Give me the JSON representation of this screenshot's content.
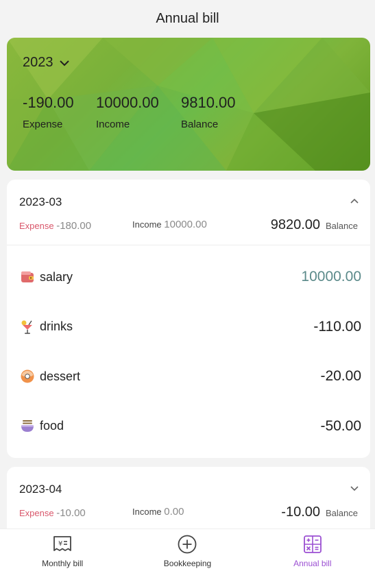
{
  "header": {
    "title": "Annual bill"
  },
  "summary": {
    "year": "2023",
    "expense_value": "-190.00",
    "expense_label": "Expense",
    "income_value": "10000.00",
    "income_label": "Income",
    "balance_value": "9810.00",
    "balance_label": "Balance"
  },
  "months": [
    {
      "title": "2023-03",
      "expanded": true,
      "expense_label": "Expense",
      "expense_value": "-180.00",
      "income_label": "Income",
      "income_value": "10000.00",
      "balance_value": "9820.00",
      "balance_label": "Balance",
      "transactions": [
        {
          "name": "salary",
          "amount": "10000.00",
          "icon": "wallet-icon"
        },
        {
          "name": "drinks",
          "amount": "-110.00",
          "icon": "cocktail-icon"
        },
        {
          "name": "dessert",
          "amount": "-20.00",
          "icon": "donut-icon"
        },
        {
          "name": "food",
          "amount": "-50.00",
          "icon": "noodles-icon"
        }
      ]
    },
    {
      "title": "2023-04",
      "expanded": false,
      "expense_label": "Expense",
      "expense_value": "-10.00",
      "income_label": "Income",
      "income_value": "0.00",
      "balance_value": "-10.00",
      "balance_label": "Balance"
    }
  ],
  "tabbar": {
    "items": [
      {
        "label": "Monthly bill",
        "icon": "receipt-icon"
      },
      {
        "label": "Bookkeeping",
        "icon": "plus-circle-icon"
      },
      {
        "label": "Annual bill",
        "icon": "calculator-icon"
      }
    ],
    "active_index": 2
  },
  "colors": {
    "expense_label": "#d9576b",
    "income_amount": "#5b8a8a",
    "active_tab": "#9b4fd2",
    "card_green": "#79b13a"
  }
}
